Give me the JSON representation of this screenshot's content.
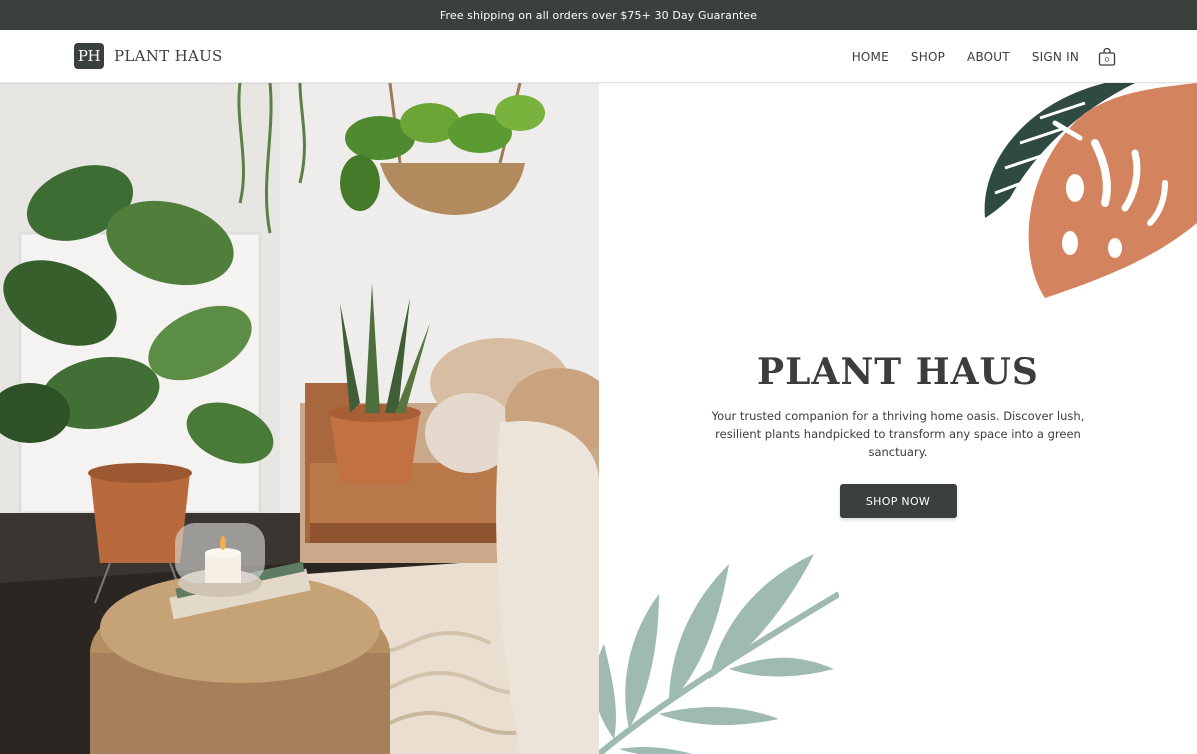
{
  "announcement": "Free shipping on all orders over $75+ 30 Day Guarantee",
  "brand": {
    "mark": "PH",
    "name": "PLANT HAUS"
  },
  "nav": {
    "items": [
      "HOME",
      "SHOP",
      "ABOUT",
      "SIGN IN"
    ],
    "cart_count": "0",
    "cart_icon": "shopping-bag-icon"
  },
  "hero": {
    "title": "PLANT HAUS",
    "subtitle": "Your trusted companion for a thriving home oasis. Discover lush, resilient plants handpicked to transform any space into a green sanctuary.",
    "cta_label": "SHOP NOW"
  },
  "colors": {
    "dark": "#3a403c",
    "terracotta": "#d4835f",
    "forest": "#2f4a42",
    "sage": "#9ebab2",
    "text": "#3a3d3b"
  }
}
